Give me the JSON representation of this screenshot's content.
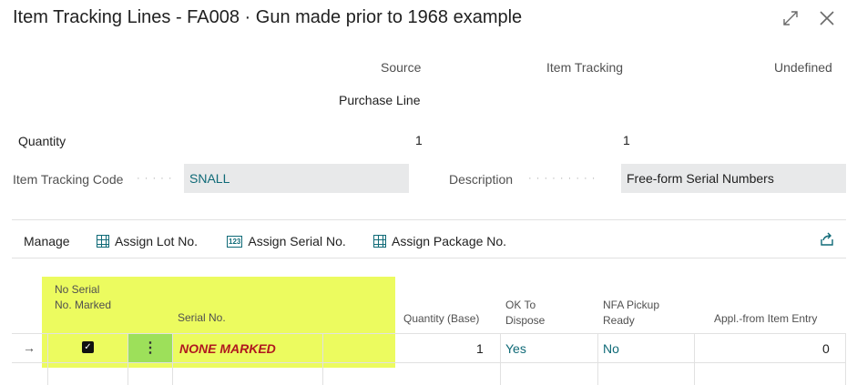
{
  "window": {
    "title": "Item Tracking Lines - FA008 · Gun made prior to 1968 example",
    "expand_icon": "expand-icon",
    "close_icon": "close-icon"
  },
  "summary": {
    "headers": {
      "source": "Source",
      "item_tracking": "Item Tracking",
      "undefined": "Undefined"
    },
    "source_value": "Purchase Line",
    "quantity_label": "Quantity",
    "quantity_source": "1",
    "quantity_item_tracking": "1"
  },
  "fields": {
    "item_tracking_code_label": "Item Tracking Code",
    "item_tracking_code_value": "SNALL",
    "description_label": "Description",
    "description_value": "Free-form Serial Numbers"
  },
  "actions": {
    "manage": "Manage",
    "assign_lot": "Assign Lot No.",
    "assign_serial": "Assign Serial No.",
    "assign_package": "Assign Package No.",
    "share_icon": "share-icon"
  },
  "table": {
    "columns": {
      "no_serial_marked": "No Serial No. Marked",
      "serial_no": "Serial No.",
      "quantity_base": "Quantity (Base)",
      "ok_to_dispose": "OK To Dispose",
      "nfa_pickup_ready": "NFA Pickup Ready",
      "appl_from_item_entry": "Appl.-from Item Entry"
    },
    "rows": [
      {
        "no_serial_marked": true,
        "serial_no": "NONE MARKED",
        "quantity_base": "1",
        "ok_to_dispose": "Yes",
        "nfa_pickup_ready": "No",
        "appl_from_item_entry": "0"
      }
    ]
  },
  "colors": {
    "accent": "#0f6a77",
    "highlight": "#ecfb5f",
    "serial_text": "#b0171f"
  }
}
